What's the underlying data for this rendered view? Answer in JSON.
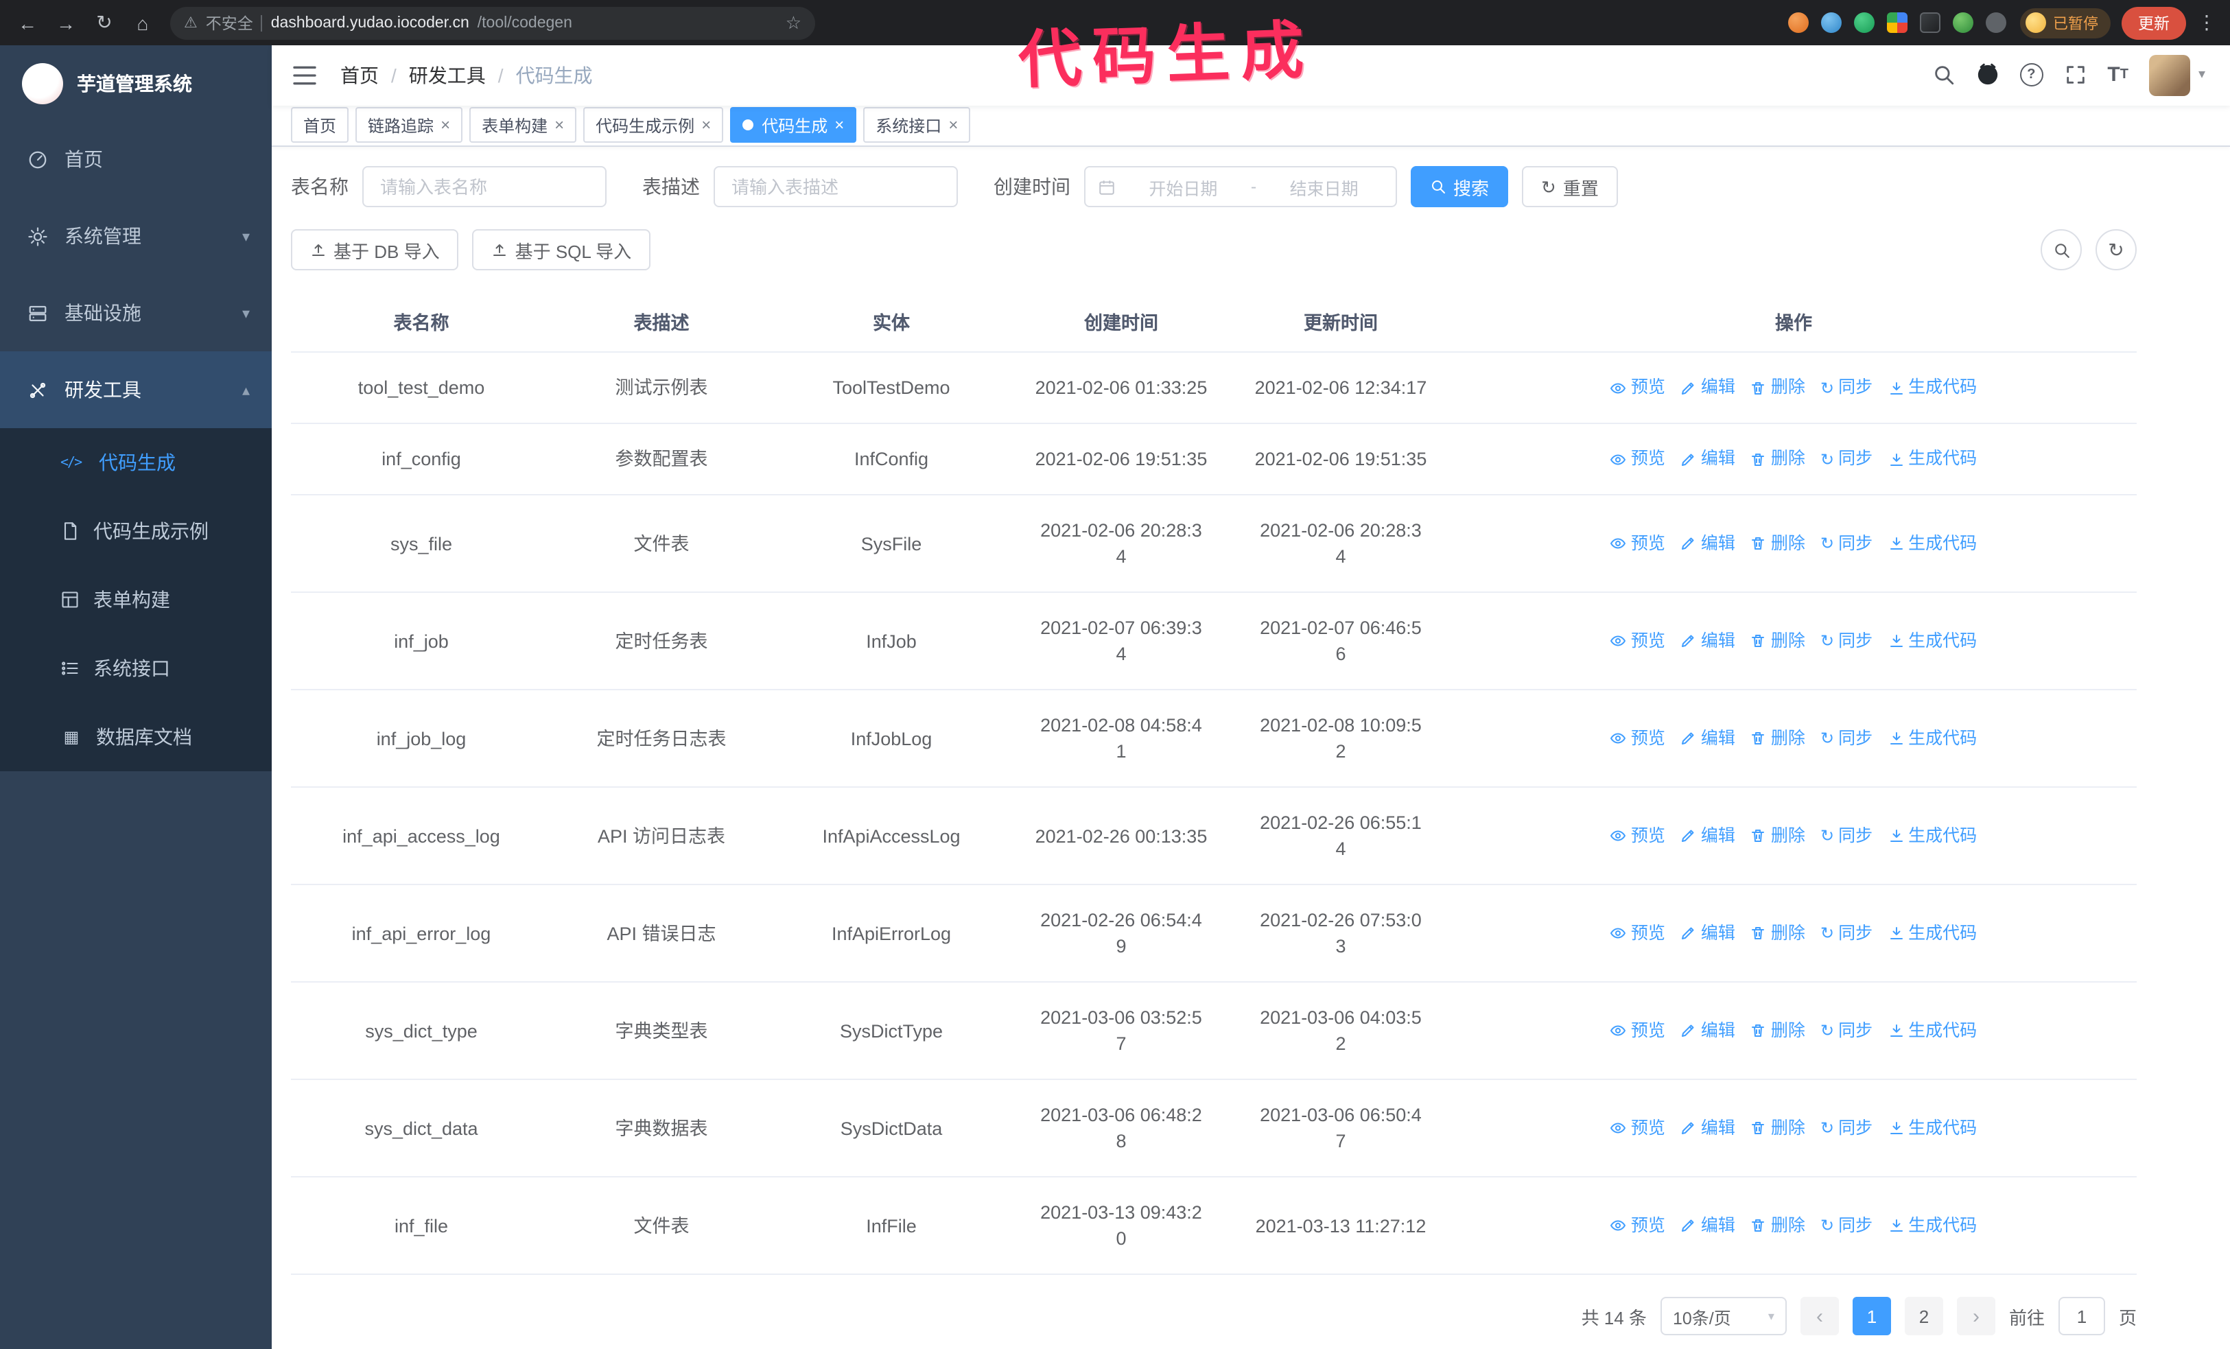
{
  "annotation": {
    "text": "代码生成",
    "color": "#fb2e5d"
  },
  "colors": {
    "accent": "#409eff",
    "sidebar_bg": "#304156",
    "submenu_bg": "#1f2d3d",
    "chrome_bg": "#202124",
    "update_button_bg": "#d9503f",
    "paused_text": "#f0a04b",
    "annotation": "#fb2e5d"
  },
  "icons": {
    "back": "←",
    "forward": "→",
    "refresh": "↻",
    "home": "⌂",
    "warning": "⚠",
    "star": "☆",
    "menu_dots": "⋮",
    "close": "×",
    "caret_down": "▾",
    "chevron_down": "▾",
    "chevron_up": "▴",
    "chevron_left": "‹",
    "chevron_right": "›",
    "sync": "↻",
    "code": "</>",
    "grid": "▦",
    "question": "?",
    "font_size": "T"
  },
  "browser": {
    "security_label": "不安全",
    "url_host": "dashboard.yudao.iocoder.cn",
    "url_path": "/tool/codegen",
    "paused_badge": "已暂停",
    "update_button": "更新"
  },
  "app": {
    "logo_title": "芋道管理系统",
    "breadcrumb": [
      "首页",
      "研发工具",
      "代码生成"
    ],
    "breadcrumb_separator": "/"
  },
  "sidebar": {
    "items": [
      {
        "label": "首页"
      },
      {
        "label": "系统管理",
        "expandable": true
      },
      {
        "label": "基础设施",
        "expandable": true
      },
      {
        "label": "研发工具",
        "expandable": true,
        "expanded": true
      }
    ],
    "submenu": [
      {
        "label": "代码生成",
        "active": true
      },
      {
        "label": "代码生成示例"
      },
      {
        "label": "表单构建"
      },
      {
        "label": "系统接口"
      },
      {
        "label": "数据库文档"
      }
    ]
  },
  "tabs": [
    {
      "label": "首页",
      "closable": false,
      "active": false
    },
    {
      "label": "链路追踪",
      "closable": true,
      "active": false
    },
    {
      "label": "表单构建",
      "closable": true,
      "active": false
    },
    {
      "label": "代码生成示例",
      "closable": true,
      "active": false
    },
    {
      "label": "代码生成",
      "closable": true,
      "active": true
    },
    {
      "label": "系统接口",
      "closable": true,
      "active": false
    }
  ],
  "filters": {
    "table_name_label": "表名称",
    "table_name_placeholder": "请输入表名称",
    "table_desc_label": "表描述",
    "table_desc_placeholder": "请输入表描述",
    "create_time_label": "创建时间",
    "date_start_placeholder": "开始日期",
    "date_separator": "-",
    "date_end_placeholder": "结束日期",
    "search_button": "搜索",
    "reset_button": "重置"
  },
  "toolbar": {
    "import_db": "基于 DB 导入",
    "import_sql": "基于 SQL 导入"
  },
  "table": {
    "columns": [
      "表名称",
      "表描述",
      "实体",
      "创建时间",
      "更新时间",
      "操作"
    ],
    "row_actions": [
      "预览",
      "编辑",
      "删除",
      "同步",
      "生成代码"
    ],
    "rows": [
      {
        "name": "tool_test_demo",
        "desc": "测试示例表",
        "entity": "ToolTestDemo",
        "created": "2021-02-06 01:33:25",
        "updated": "2021-02-06 12:34:17"
      },
      {
        "name": "inf_config",
        "desc": "参数配置表",
        "entity": "InfConfig",
        "created": "2021-02-06 19:51:35",
        "updated": "2021-02-06 19:51:35"
      },
      {
        "name": "sys_file",
        "desc": "文件表",
        "entity": "SysFile",
        "created": "2021-02-06 20:28:3\n4",
        "updated": "2021-02-06 20:28:3\n4"
      },
      {
        "name": "inf_job",
        "desc": "定时任务表",
        "entity": "InfJob",
        "created": "2021-02-07 06:39:3\n4",
        "updated": "2021-02-07 06:46:5\n6"
      },
      {
        "name": "inf_job_log",
        "desc": "定时任务日志表",
        "entity": "InfJobLog",
        "created": "2021-02-08 04:58:4\n1",
        "updated": "2021-02-08 10:09:5\n2"
      },
      {
        "name": "inf_api_access_log",
        "desc": "API 访问日志表",
        "entity": "InfApiAccessLog",
        "created": "2021-02-26 00:13:35",
        "updated": "2021-02-26 06:55:1\n4"
      },
      {
        "name": "inf_api_error_log",
        "desc": "API 错误日志",
        "entity": "InfApiErrorLog",
        "created": "2021-02-26 06:54:4\n9",
        "updated": "2021-02-26 07:53:0\n3"
      },
      {
        "name": "sys_dict_type",
        "desc": "字典类型表",
        "entity": "SysDictType",
        "created": "2021-03-06 03:52:5\n7",
        "updated": "2021-03-06 04:03:5\n2"
      },
      {
        "name": "sys_dict_data",
        "desc": "字典数据表",
        "entity": "SysDictData",
        "created": "2021-03-06 06:48:2\n8",
        "updated": "2021-03-06 06:50:4\n7"
      },
      {
        "name": "inf_file",
        "desc": "文件表",
        "entity": "InfFile",
        "created": "2021-03-13 09:43:2\n0",
        "updated": "2021-03-13 11:27:12"
      }
    ]
  },
  "pagination": {
    "total": "共 14 条",
    "page_size": "10条/页",
    "pages": [
      "1",
      "2"
    ],
    "active_page": "1",
    "goto_label": "前往",
    "goto_value": "1",
    "page_label": "页"
  }
}
